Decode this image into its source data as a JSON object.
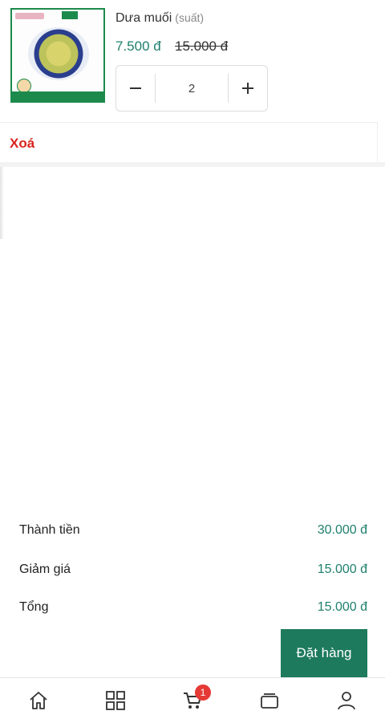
{
  "cart_item": {
    "name": "Dưa muối",
    "unit": "(suất)",
    "price_sale": "7.500 đ",
    "price_original": "15.000 đ",
    "quantity": "2",
    "delete_label": "Xoá"
  },
  "summary": {
    "subtotal_label": "Thành tiền",
    "subtotal_value": "30.000 đ",
    "discount_label": "Giảm giá",
    "discount_value": "15.000 đ",
    "total_label": "Tổng",
    "total_value": "15.000 đ"
  },
  "order_button_label": "Đặt hàng",
  "bottom_nav": {
    "items": [
      "home-icon",
      "grid-icon",
      "cart-icon",
      "orders-icon",
      "user-icon"
    ],
    "cart_badge": "1"
  },
  "colors": {
    "accent_green": "#1d7a5c",
    "price_green": "#1e7f6d",
    "delete_red": "#d8261e",
    "badge_red": "#e53935"
  }
}
